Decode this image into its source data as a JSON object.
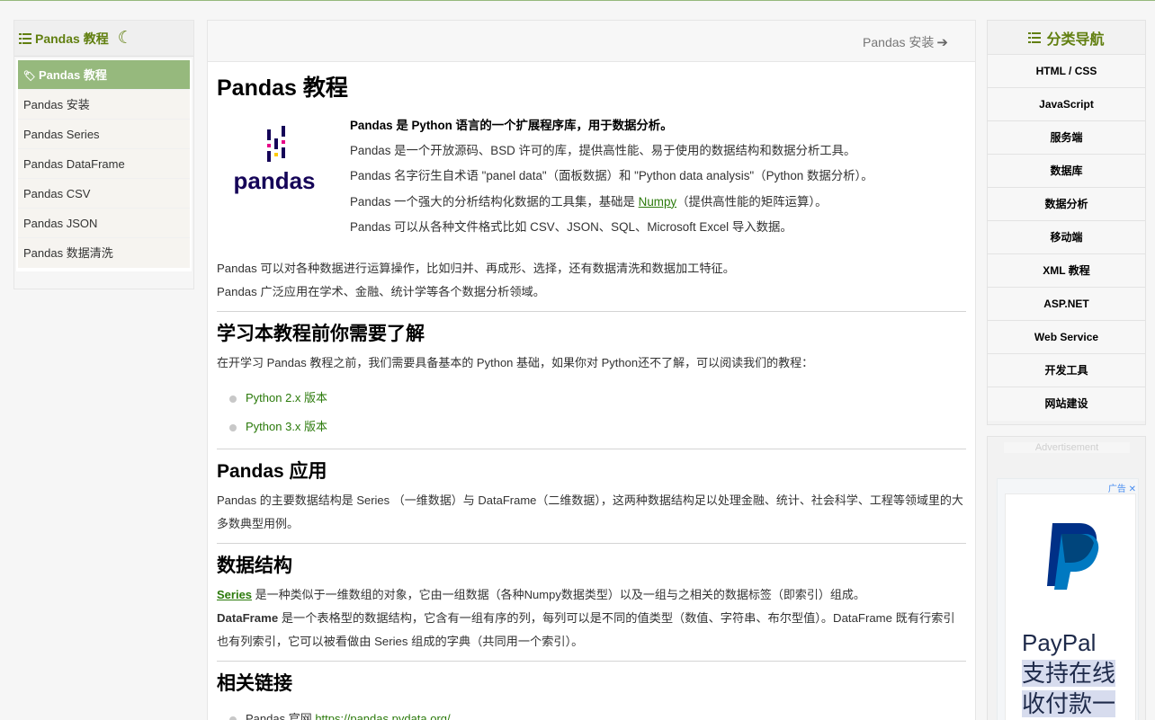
{
  "left_sidebar": {
    "title": "Pandas 教程",
    "items": [
      {
        "label": "Pandas 教程",
        "active": true
      },
      {
        "label": "Pandas 安装",
        "active": false
      },
      {
        "label": "Pandas Series",
        "active": false
      },
      {
        "label": "Pandas DataFrame",
        "active": false
      },
      {
        "label": "Pandas CSV",
        "active": false
      },
      {
        "label": "Pandas JSON",
        "active": false
      },
      {
        "label": "Pandas 数据清洗",
        "active": false
      }
    ]
  },
  "topbar": {
    "next_label": "Pandas 安装"
  },
  "article": {
    "title": "Pandas 教程",
    "logo_text": "pandas",
    "intro_bold": "Pandas 是 Python 语言的一个扩展程序库，用于数据分析。",
    "intro_lines": [
      "Pandas 是一个开放源码、BSD 许可的库，提供高性能、易于使用的数据结构和数据分析工具。",
      "Pandas 名字衍生自术语 \"panel data\"（面板数据）和 \"Python data analysis\"（Python 数据分析）。"
    ],
    "intro_numpy_prefix": "Pandas 一个强大的分析结构化数据的工具集，基础是 ",
    "intro_numpy_link": "Numpy",
    "intro_numpy_suffix": "（提供高性能的矩阵运算）。",
    "intro_last": "Pandas 可以从各种文件格式比如 CSV、JSON、SQL、Microsoft Excel 导入数据。",
    "para1": "Pandas 可以对各种数据进行运算操作，比如归并、再成形、选择，还有数据清洗和数据加工特征。",
    "para2": "Pandas 广泛应用在学术、金融、统计学等各个数据分析领域。",
    "sec1": {
      "title": "学习本教程前你需要了解",
      "text": "在开学习 Pandas 教程之前，我们需要具备基本的 Python 基础，如果你对 Python还不了解，可以阅读我们的教程：",
      "links": [
        "Python 2.x 版本",
        "Python 3.x 版本"
      ]
    },
    "sec2": {
      "title": "Pandas 应用",
      "text": "Pandas 的主要数据结构是 Series （一维数据）与 DataFrame（二维数据），这两种数据结构足以处理金融、统计、社会科学、工程等领域里的大多数典型用例。"
    },
    "sec3": {
      "title": "数据结构",
      "series_link": "Series",
      "series_text": " 是一种类似于一维数组的对象，它由一组数据（各种Numpy数据类型）以及一组与之相关的数据标签（即索引）组成。",
      "df_bold": "DataFrame",
      "df_text": " 是一个表格型的数据结构，它含有一组有序的列，每列可以是不同的值类型（数值、字符串、布尔型值）。DataFrame 既有行索引也有列索引，它可以被看做由 Series 组成的字典（共同用一个索引）。"
    },
    "sec4": {
      "title": "相关链接",
      "link_label": "Pandas 官网 ",
      "link_url": "https://pandas.pydata.org/"
    }
  },
  "right_sidebar": {
    "title": "分类导航",
    "items": [
      "HTML / CSS",
      "JavaScript",
      "服务端",
      "数据库",
      "数据分析",
      "移动端",
      "XML 教程",
      "ASP.NET",
      "Web Service",
      "开发工具",
      "网站建设"
    ]
  },
  "ad": {
    "label": "Advertisement",
    "tag": "广告",
    "lines": [
      "PayPal",
      "支持在线",
      "收付款一"
    ]
  },
  "colors": {
    "accent": "#96b97d",
    "brand_green": "#617f10",
    "link": "#2b7a0b",
    "orange": "#e0522b"
  }
}
